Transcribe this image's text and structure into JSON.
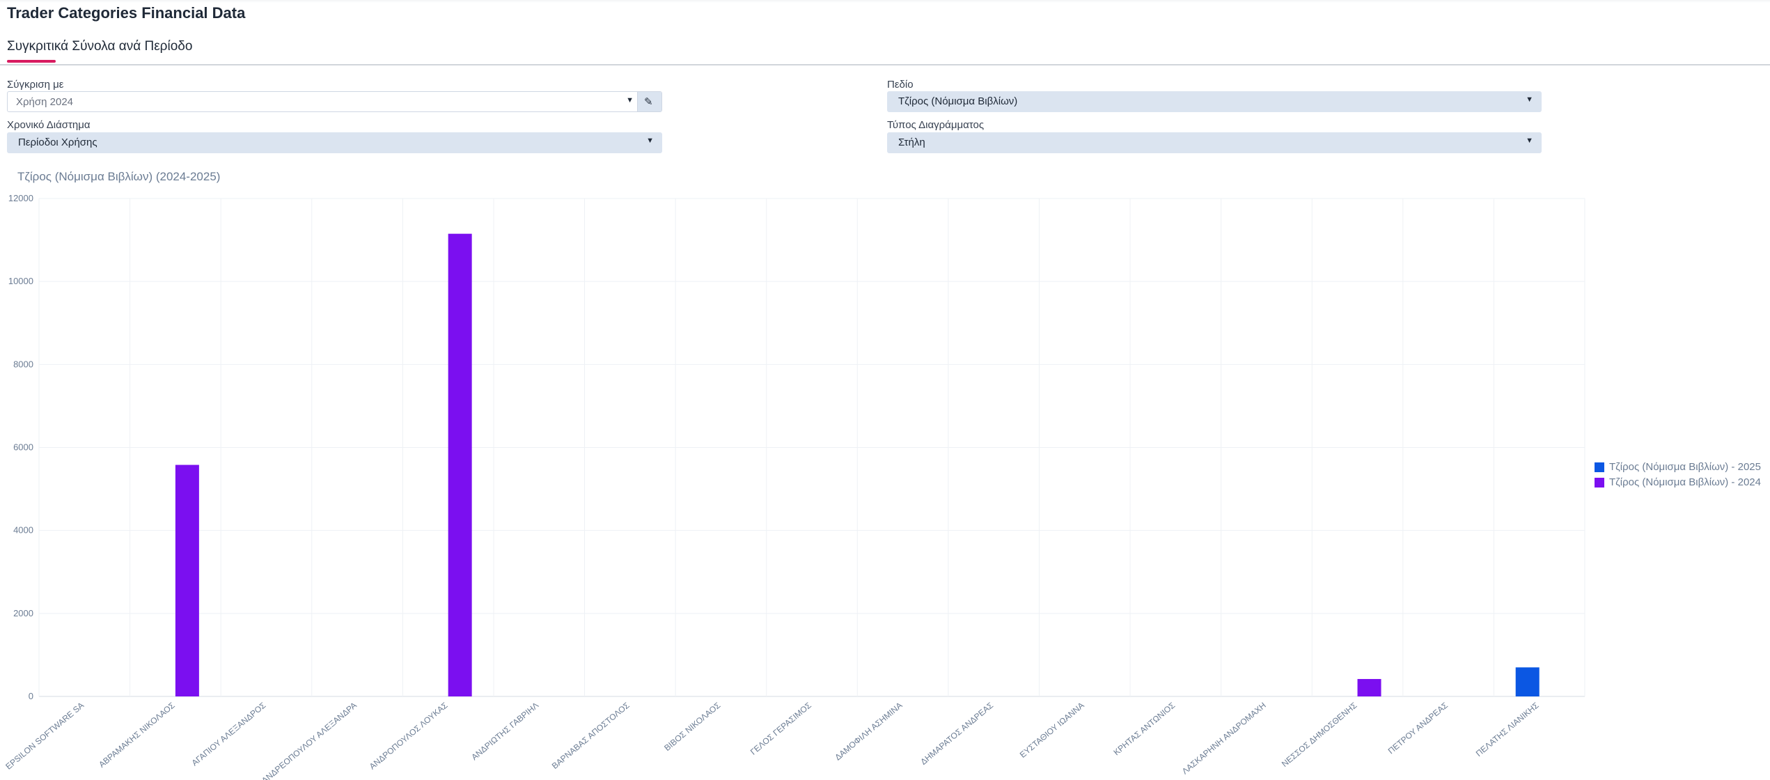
{
  "app": {
    "title": "Trader Categories Financial Data"
  },
  "tabs": [
    {
      "label": "Συγκριτικά Σύνολα ανά Περίοδο",
      "active": true
    }
  ],
  "filters": {
    "compare_label": "Σύγκριση με",
    "compare_value": "Χρήση 2024",
    "field_label": "Πεδίο",
    "field_value": "Τζίρος (Νόμισμα Βιβλίων)",
    "range_label": "Χρονικό Διάστημα",
    "range_value": "Περίοδοι Χρήσης",
    "type_label": "Τύπος Διαγράμματος",
    "type_value": "Στήλη"
  },
  "chart_data": {
    "type": "bar",
    "title": "Τζίρος (Νόμισμα Βιβλίων) (2024-2025)",
    "categories": [
      "EPSILON SOFTWARE SA",
      "ΑΒΡΑΜΑΚΗΣ ΝΙΚΟΛΑΟΣ",
      "ΑΓΑΠΙΟΥ ΑΛΕΞΑΝΔΡΟΣ",
      "ΑΝΔΡΕΟΠΟΥΛΟΥ ΑΛΕΞΑΝΔΡΑ",
      "ΑΝΔΡΟΠΟΥΛΟΣ ΛΟΥΚΑΣ",
      "ΑΝΔΡΙΩΤΗΣ ΓΑΒΡΙΗΛ",
      "ΒΑΡΝΑΒΑΣ ΑΠΟΣΤΟΛΟΣ",
      "ΒΙΒΟΣ ΝΙΚΟΛΑΟΣ",
      "ΓΕΛΟΣ ΓΕΡΑΣΙΜΟΣ",
      "ΔΑΜΟΦΙΛΗ ΑΣΗΜΙΝΑ",
      "ΔΗΜΑΡΑΤΟΣ ΑΝΔΡΕΑΣ",
      "ΕΥΣΤΑΘΙΟΥ ΙΩΑΝΝΑ",
      "ΚΡΗΤΑΣ ΑΝΤΩΝΙΟΣ",
      "ΛΑΣΚΑΡΗΝΗ ΑΝΔΡΟΜΑΧΗ",
      "ΝΕΣΣΟΣ ΔΗΜΟΣΘΕΝΗΣ",
      "ΠΕΤΡΟΥ ΑΝΔΡΕΑΣ",
      "ΠΕΛΑΤΗΣ ΛΙΑΝΙΚΗΣ"
    ],
    "series": [
      {
        "name": "Τζίρος (Νόμισμα Βιβλίων) - 2025",
        "color": "#0b57e3",
        "values": [
          0,
          0,
          0,
          0,
          0,
          0,
          0,
          0,
          0,
          0,
          0,
          0,
          0,
          0,
          0,
          0,
          700
        ]
      },
      {
        "name": "Τζίρος (Νόμισμα Βιβλίων) - 2024",
        "color": "#7b0ff0",
        "values": [
          0,
          5580,
          0,
          0,
          11150,
          0,
          0,
          0,
          0,
          0,
          0,
          0,
          0,
          0,
          420,
          0,
          0
        ]
      }
    ],
    "ylim": [
      0,
      12000
    ],
    "yticks": [
      0,
      2000,
      4000,
      6000,
      8000,
      10000,
      12000
    ],
    "grid": true,
    "legend_position": "right"
  }
}
